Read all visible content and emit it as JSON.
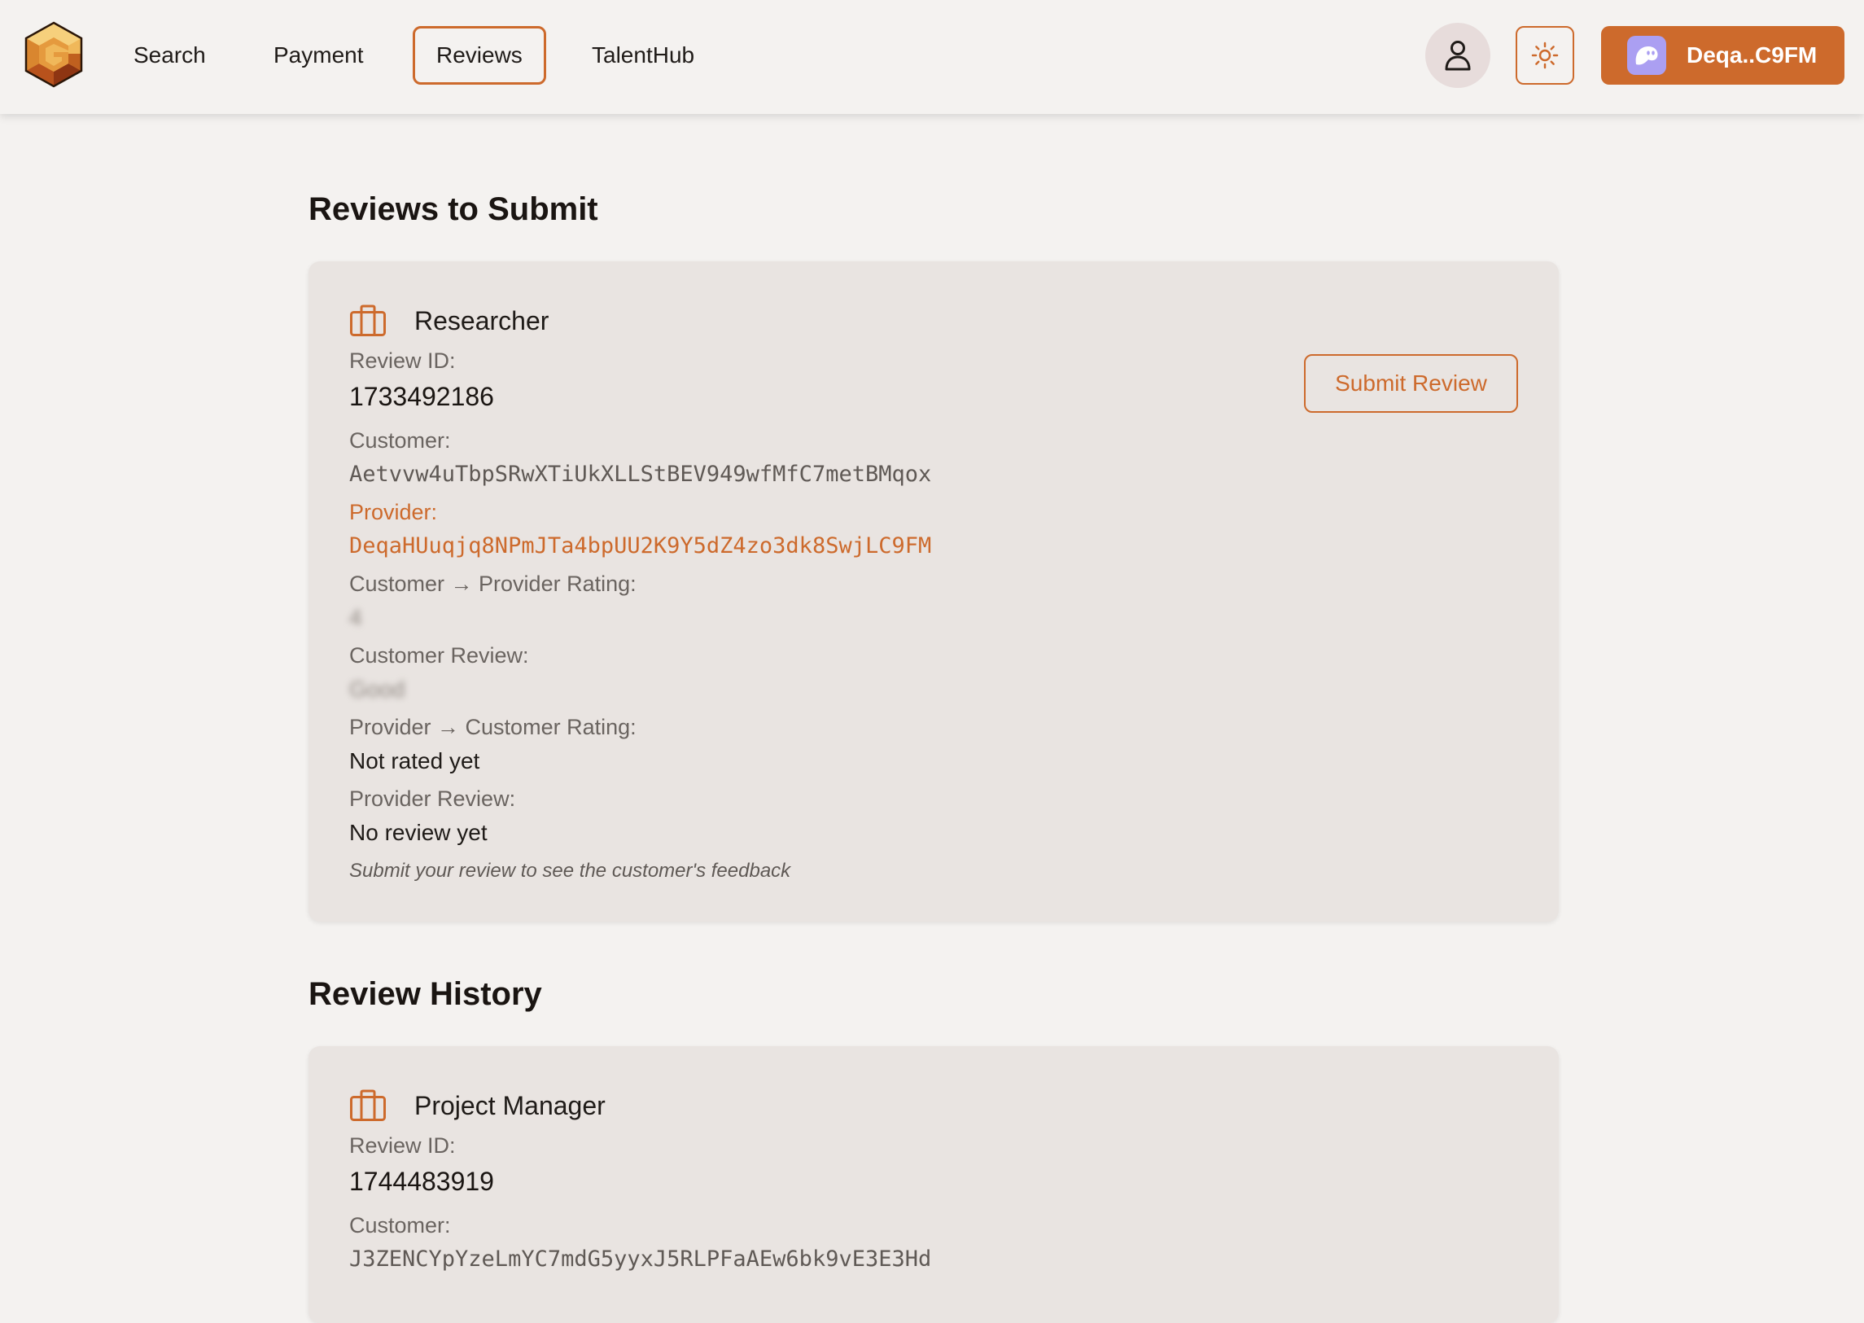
{
  "nav": {
    "links": [
      {
        "label": "Search"
      },
      {
        "label": "Payment"
      },
      {
        "label": "Reviews",
        "active": true
      },
      {
        "label": "TalentHub"
      }
    ],
    "wallet_label": "Deqa..C9FM",
    "icons": [
      "logo",
      "user-icon",
      "sun-icon",
      "phantom-ghost-icon"
    ]
  },
  "colors": {
    "accent": "#cd6a2c",
    "background": "#f4f2f0",
    "card": "#e9e4e1",
    "wallet_icon": "#ab9ff2"
  },
  "to_submit": {
    "title": "Reviews to Submit",
    "card": {
      "icon": "briefcase-icon",
      "job_title": "Researcher",
      "review_id_label": "Review ID:",
      "review_id": "1733492186",
      "customer_label": "Customer:",
      "customer": "Aetvvw4uTbpSRwXTiUkXLLStBEV949wfMfC7metBMqox",
      "provider_label": "Provider:",
      "provider": "DeqaHUuqjq8NPmJTa4bpUU2K9Y5dZ4zo3dk8SwjLC9FM",
      "c2p_rating_label": "Customer → Provider Rating:",
      "c2p_rating": "4",
      "customer_review_label": "Customer Review:",
      "customer_review": "Good",
      "p2c_rating_label": "Provider → Customer Rating:",
      "p2c_rating": "Not rated yet",
      "provider_review_label": "Provider Review:",
      "provider_review": "No review yet",
      "note": "Submit your review to see the customer's feedback",
      "submit_label": "Submit Review"
    }
  },
  "history": {
    "title": "Review History",
    "card": {
      "icon": "briefcase-icon",
      "job_title": "Project Manager",
      "review_id_label": "Review ID:",
      "review_id": "1744483919",
      "customer_label": "Customer:",
      "customer": "J3ZENCYpYzeLmYC7mdG5yyxJ5RLPFaAEw6bk9vE3E3Hd"
    }
  }
}
